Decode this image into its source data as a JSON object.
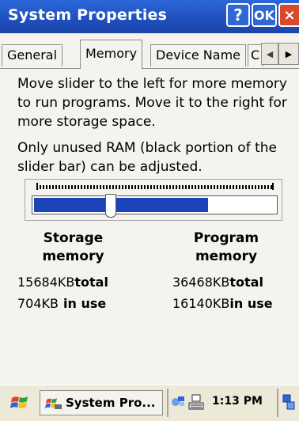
{
  "window": {
    "title": "System Properties",
    "help_label": "?",
    "ok_label": "OK",
    "close_label": "×"
  },
  "tabs": [
    {
      "label": "General",
      "active": false
    },
    {
      "label": "Memory",
      "active": true
    },
    {
      "label": "Device Name",
      "active": false
    },
    {
      "label": "C",
      "active": false
    }
  ],
  "tab_scroll": {
    "left_icon": "arrow-left-icon",
    "right_icon": "arrow-right-icon"
  },
  "memory": {
    "description": "Move slider to the left for more memory to run programs. Move it to the right for more storage space.",
    "note": "Only unused RAM (black portion of the slider bar) can be adjusted.",
    "slider": {
      "storage_fraction": 0.3,
      "used_fill_fraction": 0.72,
      "fill_color": "#1c44b8"
    },
    "storage": {
      "label_line1": "Storage",
      "label_line2": "memory",
      "total_value": "15684KB",
      "total_label": "total",
      "inuse_value": "704KB",
      "inuse_label": "in use"
    },
    "program": {
      "label_line1": "Program",
      "label_line2": "memory",
      "total_value": "36468KB",
      "total_label": "total",
      "inuse_value": "16140KB",
      "inuse_label": "in use"
    }
  },
  "taskbar": {
    "start_icon": "windows-flag-icon",
    "task_label": "System Pro...",
    "clock": "1:13 PM",
    "tray_icons": [
      "network-icon",
      "keyboard-icon",
      "connection-icon"
    ]
  }
}
